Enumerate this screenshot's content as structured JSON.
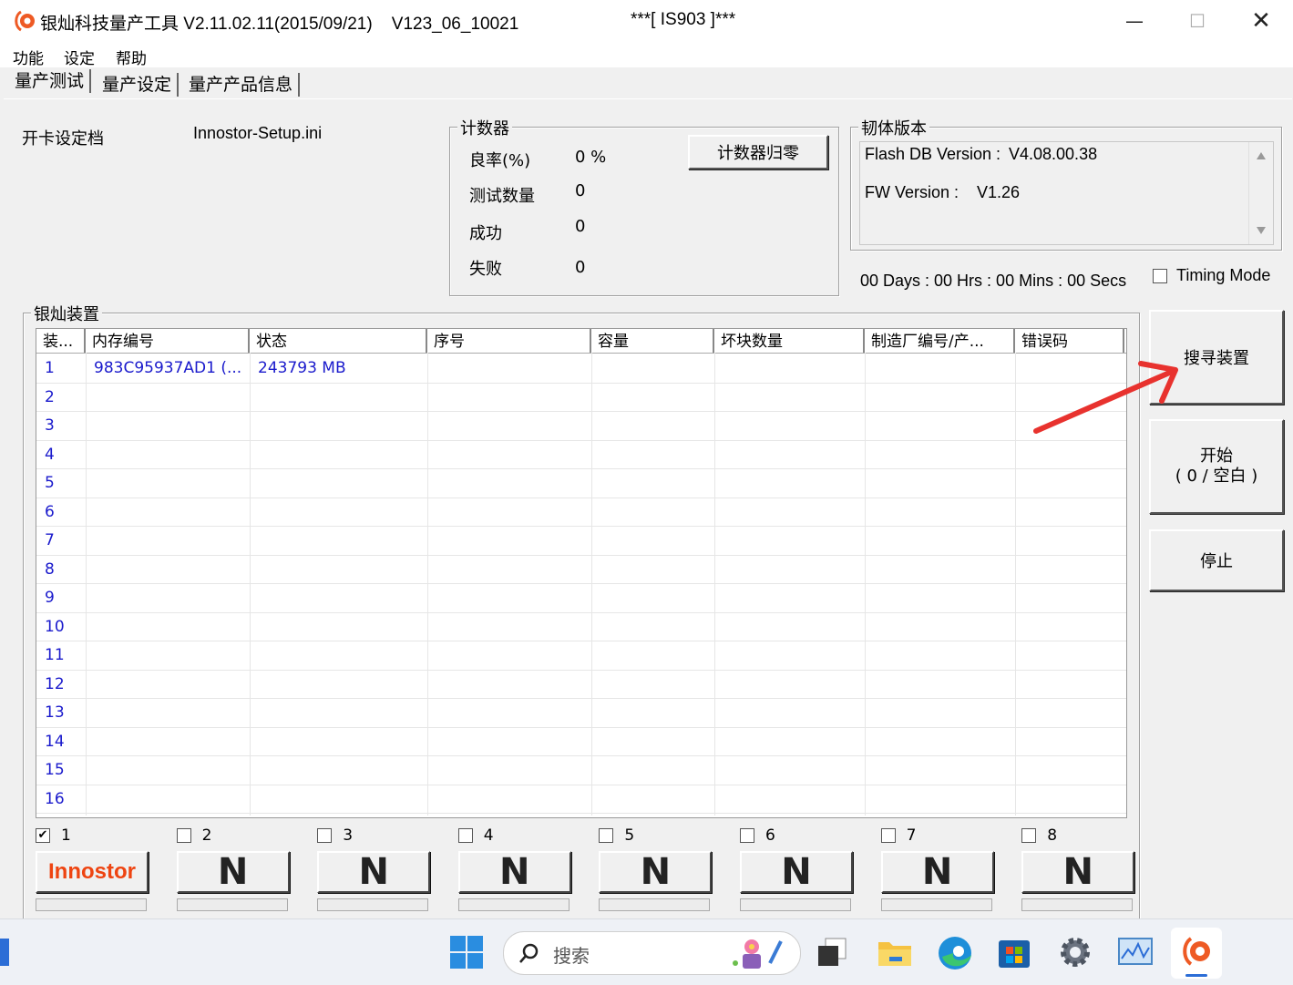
{
  "window": {
    "title": "银灿科技量产工具 V2.11.02.11(2015/09/21)    V123_06_10021",
    "title_extra": "***[ IS903 ]***",
    "minimize": "—",
    "maximize": "☐",
    "close": "✕"
  },
  "menu": [
    "功能",
    "设定",
    "帮助"
  ],
  "tabs": [
    "量产测试",
    "量产设定",
    "量产产品信息"
  ],
  "setup": {
    "label": "开卡设定档",
    "value": "Innostor-Setup.ini"
  },
  "counter": {
    "title": "计数器",
    "rows": [
      {
        "label": "良率(%)",
        "value": "0 %"
      },
      {
        "label": "测试数量",
        "value": "0"
      },
      {
        "label": "成功",
        "value": "0"
      },
      {
        "label": "失败",
        "value": "0"
      }
    ],
    "reset_button": "计数器归零"
  },
  "firmware": {
    "title": "韧体版本",
    "flash_db_label": "Flash DB Version :",
    "flash_db_value": "V4.08.00.38",
    "fw_label": "FW Version :",
    "fw_value": "V1.26"
  },
  "timer": "00 Days : 00 Hrs : 00 Mins : 00 Secs",
  "timing_mode": {
    "label": "Timing Mode",
    "checked": false
  },
  "device_group": "银灿装置",
  "table": {
    "columns": [
      "装...",
      "内存编号",
      "状态",
      "序号",
      "容量",
      "坏块数量",
      "制造厂编号/产...",
      "错误码"
    ],
    "rows": [
      {
        "no": "1",
        "mem_id": "983C95937AD1 (...",
        "status": "243793 MB"
      },
      {
        "no": "2",
        "mem_id": "",
        "status": ""
      },
      {
        "no": "3",
        "mem_id": "",
        "status": ""
      },
      {
        "no": "4",
        "mem_id": "",
        "status": ""
      },
      {
        "no": "5",
        "mem_id": "",
        "status": ""
      },
      {
        "no": "6",
        "mem_id": "",
        "status": ""
      },
      {
        "no": "7",
        "mem_id": "",
        "status": ""
      },
      {
        "no": "8",
        "mem_id": "",
        "status": ""
      },
      {
        "no": "9",
        "mem_id": "",
        "status": ""
      },
      {
        "no": "10",
        "mem_id": "",
        "status": ""
      },
      {
        "no": "11",
        "mem_id": "",
        "status": ""
      },
      {
        "no": "12",
        "mem_id": "",
        "status": ""
      },
      {
        "no": "13",
        "mem_id": "",
        "status": ""
      },
      {
        "no": "14",
        "mem_id": "",
        "status": ""
      },
      {
        "no": "15",
        "mem_id": "",
        "status": ""
      },
      {
        "no": "16",
        "mem_id": "",
        "status": ""
      }
    ]
  },
  "buttons": {
    "search": "搜寻装置",
    "start_line1": "开始",
    "start_line2": "( 0 / 空白  )",
    "stop": "停止"
  },
  "slots": [
    {
      "num": "1",
      "checked": true,
      "label": "Innostor"
    },
    {
      "num": "2",
      "checked": false,
      "label": "N"
    },
    {
      "num": "3",
      "checked": false,
      "label": "N"
    },
    {
      "num": "4",
      "checked": false,
      "label": "N"
    },
    {
      "num": "5",
      "checked": false,
      "label": "N"
    },
    {
      "num": "6",
      "checked": false,
      "label": "N"
    },
    {
      "num": "7",
      "checked": false,
      "label": "N"
    },
    {
      "num": "8",
      "checked": false,
      "label": "N"
    }
  ],
  "taskbar": {
    "search_placeholder": "搜索",
    "icons": [
      "windows-start-icon",
      "search-icon",
      "task-view-icon",
      "file-explorer-icon",
      "edge-browser-icon",
      "microsoft-store-icon",
      "settings-gear-icon",
      "performance-monitor-icon",
      "innostor-app-icon"
    ]
  },
  "colors": {
    "accent_red": "#e8322e",
    "table_text": "#1a1acc",
    "brand_orange": "#ee4411"
  }
}
